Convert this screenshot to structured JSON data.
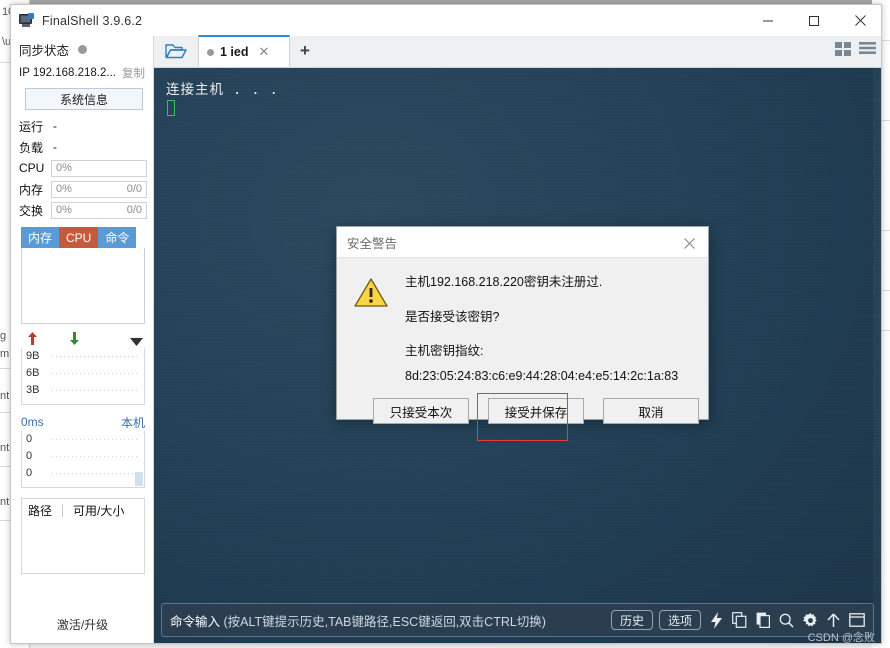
{
  "window": {
    "title": "FinalShell 3.9.6.2",
    "icon": "monitor-icon",
    "minimize": "—",
    "maximize": "□",
    "close": "✕"
  },
  "sidebar": {
    "sync_label": "同步状态",
    "ip_label": "IP 192.168.218.2...",
    "copy_label": "复制",
    "sysinfo_button": "系统信息",
    "stats": [
      {
        "key": "运行",
        "value": "-",
        "boxed": false
      },
      {
        "key": "负载",
        "value": "-",
        "boxed": false
      },
      {
        "key": "CPU",
        "value": "0%",
        "right": "",
        "boxed": true
      },
      {
        "key": "内存",
        "value": "0%",
        "right": "0/0",
        "boxed": true
      },
      {
        "key": "交换",
        "value": "0%",
        "right": "0/0",
        "boxed": true
      }
    ],
    "mini_tabs": [
      {
        "label": "内存",
        "active": false
      },
      {
        "label": "CPU",
        "active": true
      },
      {
        "label": "命令",
        "active": false
      }
    ],
    "net_graph": {
      "up_icon": "arrow-up-icon",
      "down_icon": "arrow-down-icon",
      "menu_icon": "caret-down-icon",
      "y_labels": [
        "9B",
        "6B",
        "3B"
      ]
    },
    "ping_graph": {
      "latency": "0ms",
      "host_label": "本机",
      "y_labels": [
        "0",
        "0",
        "0"
      ]
    },
    "disk": {
      "col_path": "路径",
      "col_size": "可用/大小"
    },
    "activate_label": "激活/升级"
  },
  "tab_bar": {
    "open_folder_icon": "open-folder-icon",
    "tabs": [
      {
        "label": "1 ied",
        "close": "✕",
        "active": true
      }
    ],
    "new_tab": "+",
    "grid_view_icon": "grid-view-icon",
    "list_view_icon": "list-view-icon"
  },
  "terminal": {
    "lines": [
      "连接主机 . . ."
    ],
    "cursor": "block-cursor"
  },
  "command_bar": {
    "label_main": "命令输入",
    "label_hint": "(按ALT键提示历史,TAB键路径,ESC键返回,双击CTRL切换)",
    "history_button": "历史",
    "options_button": "选项",
    "icons": [
      "lightning-icon",
      "copy-icon",
      "paste-icon",
      "search-icon",
      "gear-icon",
      "arrow-up-icon",
      "window-icon"
    ]
  },
  "watermark": "CSDN @念败",
  "dialog": {
    "title": "安全警告",
    "close": "✕",
    "warning_icon": "warning-triangle-icon",
    "line1": "主机192.168.218.220密钥未注册过.",
    "line2": "是否接受该密钥?",
    "line3": "主机密钥指纹:",
    "fingerprint": "8d:23:05:24:83:c6:e9:44:28:04:e4:e5:14:2c:1a:83",
    "buttons": [
      {
        "label": "只接受本次",
        "highlighted": false
      },
      {
        "label": "接受并保存",
        "highlighted": true
      },
      {
        "label": "取消",
        "highlighted": false
      }
    ]
  },
  "background": {
    "fragments": [
      "g",
      "m",
      "nt",
      "nt",
      "nt"
    ],
    "top_left_fragment": "10"
  },
  "colors": {
    "accent_blue": "#2e8ce0",
    "tab_blue": "#5b9bd5",
    "tab_active_orange": "#c55a3c",
    "terminal_bg": "#234157",
    "highlight_red": "#e83b36",
    "cursor_green": "#35c15e"
  }
}
